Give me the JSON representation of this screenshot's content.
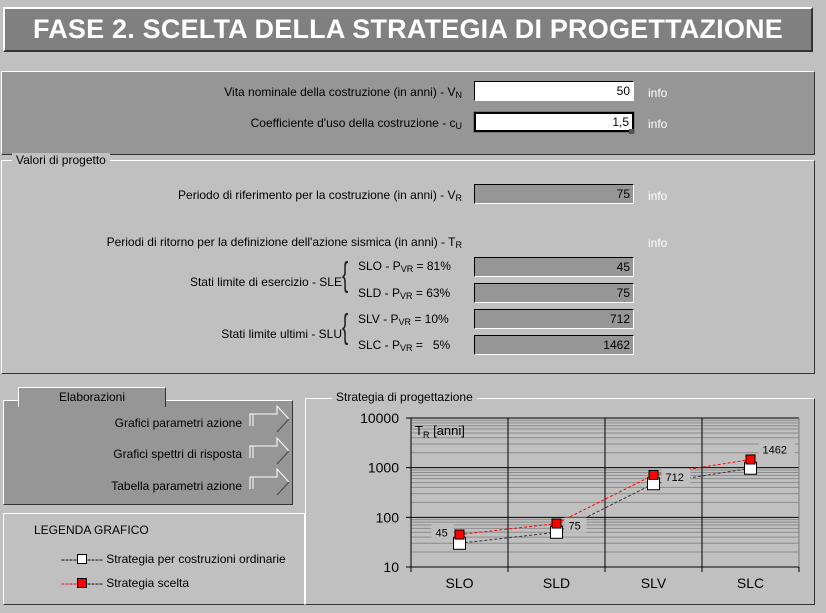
{
  "header": {
    "title": "FASE 2. SCELTA DELLA STRATEGIA DI PROGETTAZIONE"
  },
  "inputs": {
    "vita_nominale": {
      "label": "Vita nominale della costruzione (in anni) - V",
      "sub": "N",
      "value": "50",
      "info": "info"
    },
    "coeff_uso": {
      "label": "Coefficiente d'uso della costruzione - c",
      "sub": "U",
      "value": "1,5",
      "info": "info"
    }
  },
  "valori": {
    "legend": "Valori di progetto",
    "periodo_riferimento": {
      "label": "Periodo di riferimento per la costruzione (in anni) - V",
      "sub": "R",
      "value": "75",
      "info": "info"
    },
    "periodi_ritorno": {
      "label": "Periodi di ritorno per la definizione dell'azione sismica (in anni) - T",
      "sub": "R",
      "info": "info"
    },
    "sle_label": "Stati limite di esercizio - SLE",
    "slu_label": "Stati limite ultimi - SLU",
    "states": [
      {
        "name": "SLO - P",
        "sub": "VR",
        "pct": " = 81%",
        "value": "45"
      },
      {
        "name": "SLD - P",
        "sub": "VR",
        "pct": " = 63%",
        "value": "75"
      },
      {
        "name": "SLV - P",
        "sub": "VR",
        "pct": " = 10%",
        "value": "712"
      },
      {
        "name": "SLC - P",
        "sub": "VR",
        "pct": " =   5%",
        "value": "1462"
      }
    ]
  },
  "elaborazioni": {
    "tab": "Elaborazioni",
    "links": [
      {
        "label": "Grafici  parametri  azione"
      },
      {
        "label": "Grafici  spettri di risposta"
      },
      {
        "label": "Tabella  parametri  azione"
      }
    ]
  },
  "legenda": {
    "title": "LEGENDA GRAFICO",
    "items": [
      {
        "prefix": "----",
        "suffix": "---- Strategia per costruzioni ordinarie",
        "color": "#ffffff"
      },
      {
        "prefix": "----",
        "suffix": "---- Strategia scelta",
        "color": "#ff0000"
      }
    ]
  },
  "chart_data": {
    "type": "line",
    "title": "Strategia di progettazione",
    "ylabel": "T",
    "ylabel_sub": "R",
    "ylabel_suffix": " [anni]",
    "yscale": "log",
    "ylim": [
      10,
      10000
    ],
    "yticks": [
      "10",
      "100",
      "1000",
      "10000"
    ],
    "categories": [
      "SLO",
      "SLD",
      "SLV",
      "SLC"
    ],
    "grid": true,
    "series": [
      {
        "name": "Strategia per costruzioni ordinarie",
        "values": [
          30,
          50,
          475,
          975
        ],
        "marker_color": "#ffffff",
        "line_color": "#333333"
      },
      {
        "name": "Strategia scelta",
        "values": [
          45,
          75,
          712,
          1462
        ],
        "marker_color": "#ff0000",
        "line_color": "#ff0000",
        "labels": [
          "45",
          "75",
          "712",
          "1462"
        ]
      }
    ]
  }
}
